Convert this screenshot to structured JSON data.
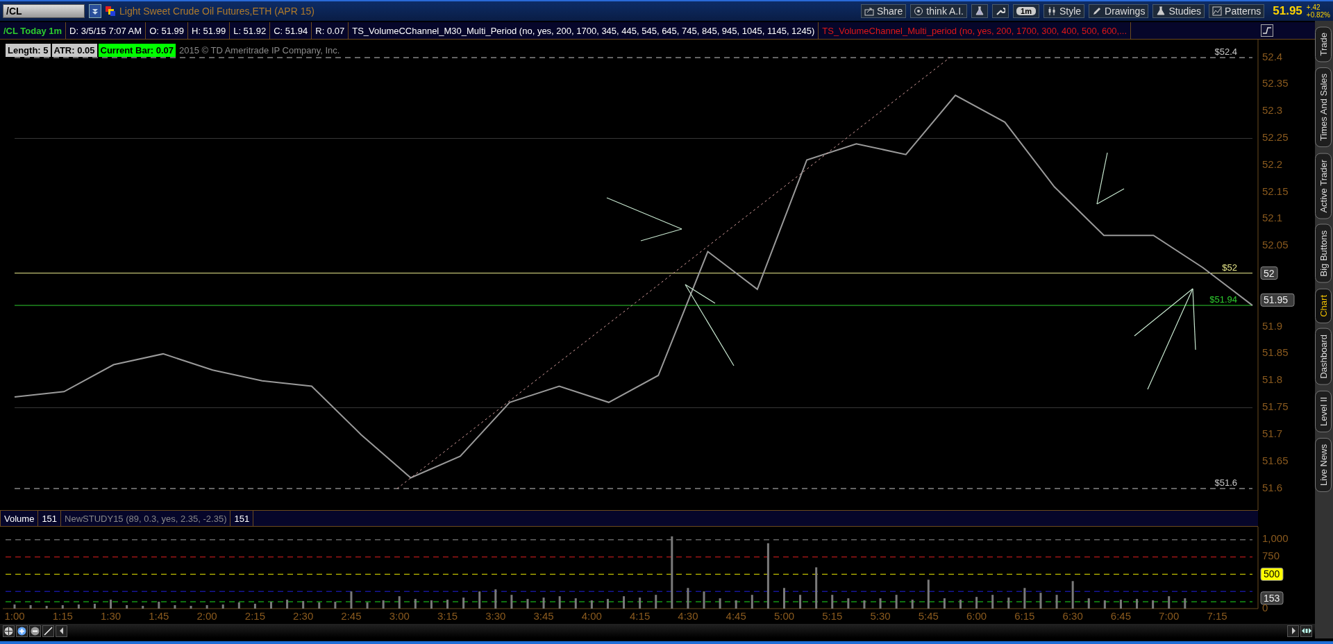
{
  "toolbar": {
    "symbol": "/CL",
    "title": "Light Sweet Crude Oil Futures,ETH (APR 15)",
    "buttons": [
      {
        "kind": "share",
        "label": "Share"
      },
      {
        "kind": "think",
        "label": "think A.I."
      },
      {
        "kind": "flask"
      },
      {
        "kind": "wrench"
      },
      {
        "kind": "interval",
        "label": "1m"
      },
      {
        "kind": "style",
        "label": "Style"
      },
      {
        "kind": "drawings",
        "label": "Drawings"
      },
      {
        "kind": "studies",
        "label": "Studies"
      },
      {
        "kind": "patterns",
        "label": "Patterns"
      }
    ],
    "quote": {
      "last": "51.95",
      "change": "+.42",
      "change_pct": "+0.82%"
    }
  },
  "info_bar": [
    {
      "kind": "symbol",
      "text": "/CL Today 1m"
    },
    {
      "kind": "plain",
      "text": "D: 3/5/15 7:07 AM"
    },
    {
      "kind": "plain",
      "text": "O: 51.99"
    },
    {
      "kind": "plain",
      "text": "H: 51.99"
    },
    {
      "kind": "plain",
      "text": "L: 51.92"
    },
    {
      "kind": "plain",
      "text": "C: 51.94"
    },
    {
      "kind": "plain",
      "text": "R: 0.07"
    },
    {
      "kind": "study",
      "text": "TS_VolumeCChannel_M30_Multi_Period (no, yes, 200, 1700, 345, 445, 545, 645, 745, 845, 945, 1045, 1145, 1245)"
    },
    {
      "kind": "study_alert",
      "text": "TS_VolumeChannel_Multi_period (no, yes, 200, 1700, 300, 400, 500, 600,..."
    }
  ],
  "price_panel": {
    "indicators": [
      {
        "kind": "gray",
        "text": "Length: 5"
      },
      {
        "kind": "gray",
        "text": "ATR: 0.05"
      },
      {
        "kind": "green",
        "text": "Current Bar: 0.07"
      },
      {
        "kind": "note",
        "text": "2015 © TD Ameritrade IP Company, Inc."
      }
    ],
    "chart_data": {
      "type": "line",
      "categories": [
        null,
        null,
        null,
        null,
        null,
        null,
        null,
        null,
        null,
        null,
        null,
        null,
        null,
        null,
        null,
        null,
        null,
        null,
        null,
        null,
        null,
        null,
        null,
        null,
        null,
        null
      ],
      "ylim": [
        51.6,
        52.4
      ],
      "yticks": [
        52.4,
        52.35,
        52.3,
        52.25,
        52.2,
        52.15,
        52.1,
        52.05,
        51.9,
        51.85,
        51.8,
        51.75,
        51.7,
        51.65,
        51.6
      ],
      "series": [
        {
          "color": "#9a9a9a",
          "values": [
            51.77,
            51.78,
            51.83,
            51.85,
            51.82,
            51.8,
            51.79,
            51.7,
            51.62,
            51.66,
            51.76,
            51.79,
            51.76,
            51.81,
            52.04,
            51.97,
            52.21,
            52.24,
            52.22,
            52.33,
            52.28,
            52.16,
            52.07,
            52.07,
            52.01,
            51.94
          ]
        }
      ],
      "ref_lines": [
        {
          "axis": "y",
          "value": 52.4,
          "color": "#c8c8c8",
          "label": "$52.4"
        },
        {
          "axis": "y",
          "value": 52.25,
          "color": "#3a3a3a"
        },
        {
          "axis": "y",
          "value": 52,
          "color": "#e6e68a",
          "label": "$52"
        },
        {
          "axis": "y",
          "value": 51.94,
          "color": "#2ecc2e",
          "label": "$51.94"
        },
        {
          "axis": "y",
          "value": 51.75,
          "color": "#3a3a3a"
        },
        {
          "axis": "y",
          "value": 51.6,
          "color": "#c8c8c8",
          "label": "$51.6"
        }
      ]
    },
    "badges": [
      {
        "text": "52",
        "color": "#3c3c3c"
      },
      {
        "text": "51.95",
        "color": "#3c3c3c"
      }
    ]
  },
  "volume_panel": {
    "header": [
      {
        "kind": "label",
        "text": "Volume"
      },
      {
        "kind": "value",
        "text": "151"
      },
      {
        "kind": "study",
        "text": "NewSTUDY15 (89, 0.3, yes, 2.35, -2.35)"
      },
      {
        "kind": "value",
        "text": "151"
      }
    ],
    "chart_data": {
      "type": "bar",
      "ylim": [
        0,
        1190
      ],
      "categories": [
        "1:00",
        null,
        null,
        "1:15",
        null,
        null,
        "1:30",
        null,
        null,
        "1:45",
        null,
        null,
        "2:00",
        null,
        null,
        "2:15",
        null,
        null,
        "2:30",
        null,
        null,
        "2:45",
        null,
        null,
        "3:00",
        null,
        null,
        "3:15",
        null,
        null,
        "3:30",
        null,
        null,
        "3:45",
        null,
        null,
        "4:00",
        null,
        null,
        "4:15",
        null,
        null,
        "4:30",
        null,
        null,
        "4:45",
        null,
        null,
        "5:00",
        null,
        null,
        "5:15",
        null,
        null,
        "5:30",
        null,
        null,
        "5:45",
        null,
        null,
        "6:00",
        null,
        null,
        "6:15",
        null,
        null,
        "6:30",
        null,
        null,
        "6:45",
        null,
        null,
        "7:00",
        null,
        null,
        "7:15"
      ],
      "yticks": [
        {
          "value": 1000,
          "label": "1,000"
        },
        750,
        0
      ],
      "series": [
        {
          "color": "#7a7a7a",
          "values": [
            60,
            50,
            40,
            50,
            60,
            70,
            130,
            50,
            40,
            100,
            50,
            40,
            50,
            60,
            90,
            70,
            100,
            130,
            110,
            90,
            100,
            250,
            90,
            120,
            180,
            140,
            120,
            130,
            160,
            250,
            280,
            200,
            140,
            160,
            180,
            150,
            120,
            140,
            180,
            160,
            200,
            1050,
            300,
            250,
            150,
            120,
            200,
            950,
            300,
            200,
            600,
            200,
            150,
            120,
            150,
            200,
            130,
            420,
            150,
            130,
            170,
            200,
            160,
            300,
            230,
            200,
            400,
            150,
            120,
            130,
            140,
            120,
            180,
            150,
            null,
            null
          ]
        }
      ],
      "ref_lines": [
        {
          "axis": "y",
          "value": 1000,
          "color": "#9a9a9a"
        },
        {
          "axis": "y",
          "value": 750,
          "color": "#e02020"
        },
        {
          "axis": "y",
          "value": 500,
          "color": "#e8e800"
        },
        {
          "axis": "y",
          "value": 250,
          "color": "#2020e0"
        },
        {
          "axis": "y",
          "value": 100,
          "color": "#20e020"
        }
      ]
    },
    "badges": [
      {
        "text": "500",
        "color": "#ffff00"
      },
      {
        "text": "153",
        "color": "#3c3c3c"
      }
    ]
  },
  "side_tabs": [
    {
      "label": "Trade",
      "selected": false
    },
    {
      "label": "Times And Sales",
      "selected": false
    },
    {
      "label": "Active Trader",
      "selected": false
    },
    {
      "label": "Big Buttons",
      "selected": false
    },
    {
      "label": "Chart",
      "selected": true
    },
    {
      "label": "Dashboard",
      "selected": false
    },
    {
      "label": "Level II",
      "selected": false
    },
    {
      "label": "Live News",
      "selected": false
    }
  ]
}
